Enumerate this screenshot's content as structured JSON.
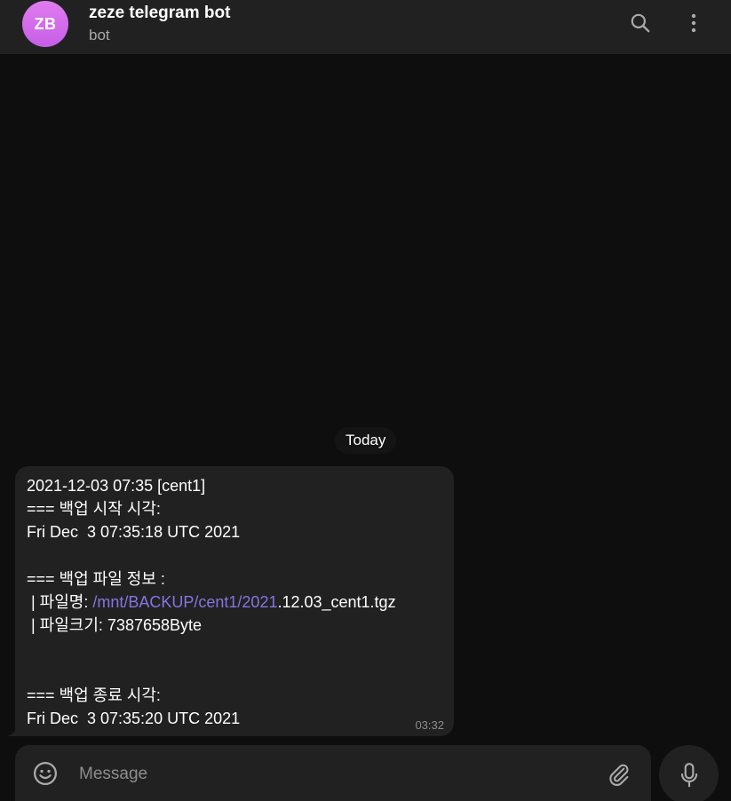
{
  "header": {
    "avatar_initials": "ZB",
    "title": "zeze telegram bot",
    "subtitle": "bot",
    "search_icon": "search-icon",
    "more_icon": "more-vertical-icon"
  },
  "date_separator": "Today",
  "message": {
    "lines": [
      "2021-12-03 07:35 [cent1]",
      "=== 백업 시작 시각:",
      "Fri Dec  3 07:35:18 UTC 2021",
      "",
      "=== 백업 파일 정보 :",
      "",
      " | 파일크기: 7387658Byte",
      "",
      "",
      "=== 백업 종료 시각:",
      "Fri Dec  3 07:35:20 UTC 2021"
    ],
    "filename_prefix": " | 파일명: ",
    "filename_link": "/mnt/BACKUP/cent1/2021",
    "filename_suffix": ".12.03_cent1.tgz",
    "time": "03:32"
  },
  "composer": {
    "placeholder": "Message",
    "emoji_icon": "smiley-icon",
    "attach_icon": "paperclip-icon",
    "mic_icon": "microphone-icon"
  },
  "colors": {
    "background": "#0e0e0e",
    "surface": "#212121",
    "avatar": "#d66df0",
    "link": "#8774e1",
    "secondary_text": "#aaaaaa"
  }
}
